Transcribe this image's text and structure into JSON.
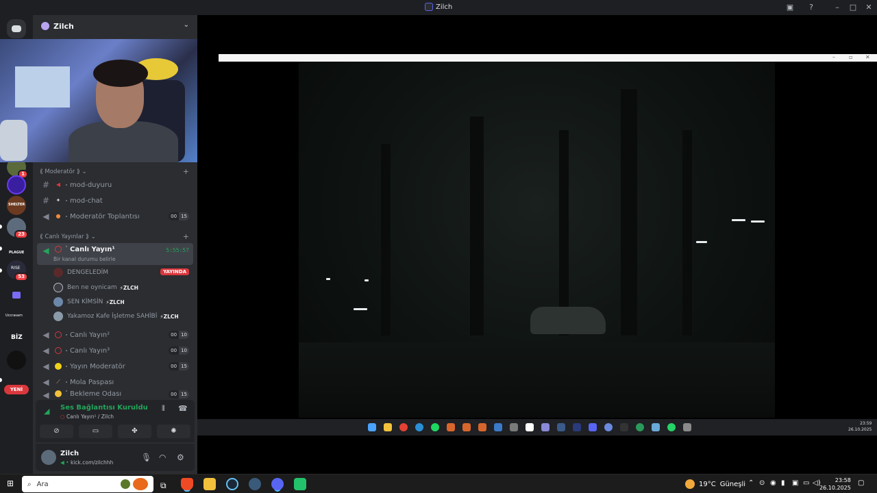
{
  "window": {
    "title": "Zilch"
  },
  "server": {
    "name": "Zilch"
  },
  "rail": {
    "badges": [
      "1",
      "23",
      "53"
    ],
    "labels": {
      "shelter": "SHELTER",
      "plague": "PLAGUE",
      "rise": "RISE",
      "ucc": "Uccrasam",
      "biz": "BİZ",
      "new": "YENİ"
    }
  },
  "categories": {
    "moderator": "⟪ Moderatör ⟫",
    "live": "⟪ Canlı Yayınlar ⟫"
  },
  "channels": {
    "mod_duyuru": "mod-duyuru",
    "mod_chat": "mod-chat",
    "mod_meeting": "Moderatör Toplantısı",
    "live1": "Canlı Yayın¹",
    "live1_timer": "5:55:57",
    "live1_status": "Bir kanal durumu belirle",
    "live2": "Canlı Yayın²",
    "live3": "Canlı Yayın³",
    "stream_mod": "Yayın Moderatör",
    "break": "Mola Paspası",
    "waiting": "Bekleme Odası"
  },
  "counts": {
    "mod_meeting": [
      "00",
      "15"
    ],
    "live2": [
      "00",
      "10"
    ],
    "live3": [
      "00",
      "10"
    ],
    "stream_mod": [
      "00",
      "15"
    ],
    "waiting": [
      "00",
      "15"
    ]
  },
  "voice_users": [
    {
      "name": "DENGELEDİM",
      "tag": "",
      "badge": "YAYINDA"
    },
    {
      "name": "Ben ne oynicam",
      "tag": "⚡ZLCH",
      "badge": ""
    },
    {
      "name": "SEN KİMSİN",
      "tag": "⚡ZLCH",
      "badge": ""
    },
    {
      "name": "Yakamoz Kafe İşletme SAHİBİ",
      "tag": "⚡ZLCH",
      "badge": ""
    }
  ],
  "voice_panel": {
    "status": "Ses Bağlantısı Kuruldu",
    "channel": "Canlı Yayın¹ / Zilch"
  },
  "user_panel": {
    "name": "Zilch",
    "status": "kick.com/zilchhh"
  },
  "taskbar": {
    "search_placeholder": "Ara",
    "weather": "19°C",
    "weather_desc": "Güneşli",
    "time": "23:58",
    "date": "26.10.2025"
  },
  "inner_taskbar": {
    "time": "23:59",
    "date": "26.10.2025"
  },
  "colors": {
    "accent": "#5865f2",
    "online": "#23a55a",
    "live": "#da373c"
  }
}
